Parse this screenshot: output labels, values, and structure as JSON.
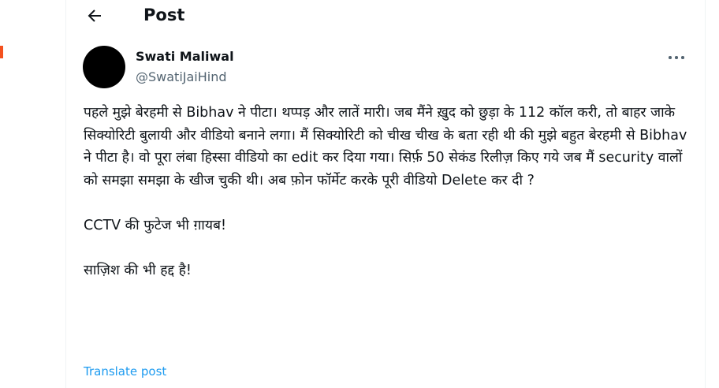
{
  "header": {
    "title": "Post",
    "back_icon": "arrow-left-icon"
  },
  "author": {
    "name": "Swati Maliwal",
    "handle": "@SwatiJaiHind"
  },
  "post": {
    "paragraph_1": "पहले मुझे बेरहमी से Bibhav ने पीटा। थप्पड़ और लातें मारी। जब मैंने ख़ुद को छुड़ा के 112 कॉल करी, तो बाहर जाके सिक्योरिटी बुलायी और वीडियो बनाने लगा। मैं सिक्योरिटी को चीख चीख के बता रही थी की मुझे बहुत बेरहमी से Bibhav ने पीटा है। वो पूरा लंबा हिस्सा वीडियो का edit कर दिया गया। सिर्फ़ 50 सेकंड रिलीज़ किए गये जब मैं security वालों को समझा समझा के खीज चुकी थी। अब फ़ोन फॉर्मेट करके पूरी वीडियो Delete कर दी ?",
    "paragraph_2": "CCTV की फुटेज भी ग़ायब!",
    "paragraph_3": "साज़िश की भी हद्द है!"
  },
  "translate_label": "Translate post",
  "colors": {
    "text": "#0f1419",
    "secondary": "#536471",
    "link": "#1d9bf0",
    "avatar": "#000000",
    "marker": "#f4511e"
  }
}
